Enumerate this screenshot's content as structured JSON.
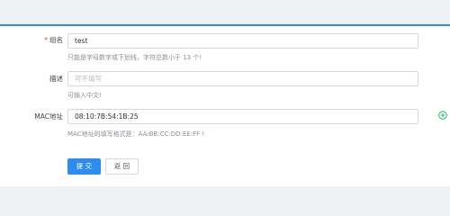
{
  "form": {
    "name": {
      "required_mark": "*",
      "label": "组名",
      "value": "test",
      "hint": "只能是字母数字或下划线，字符总数小于 13 个!"
    },
    "description": {
      "label": "描述",
      "placeholder": "可不填写",
      "value": "",
      "hint": "可输入中文!"
    },
    "mac": {
      "label": "MAC地址",
      "value": "08:10:7B:54:1B:25",
      "hint": "MAC地址的填写格式是：AA:BB:CC:DD:EE:FF !",
      "add_icon": "plus-circle-icon"
    }
  },
  "buttons": {
    "submit": "提 交",
    "back": "返 回"
  },
  "colors": {
    "accent": "#2d8cf0",
    "required": "#ed4014",
    "add_icon": "#19be6b"
  }
}
